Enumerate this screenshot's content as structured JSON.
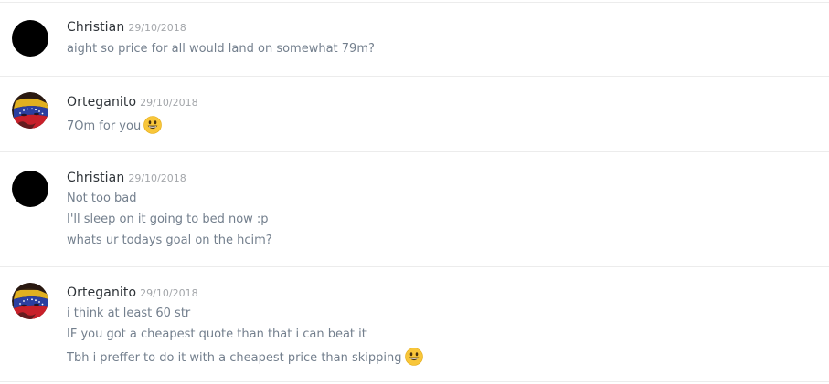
{
  "messages": [
    {
      "author": "Christian",
      "timestamp": "29/10/2018",
      "avatar": "black-circle-avatar",
      "lines": [
        {
          "text": "aight so price for all would land on somewhat 79m?",
          "emoji": null
        }
      ]
    },
    {
      "author": "Orteganito",
      "timestamp": "29/10/2018",
      "avatar": "flag-face-avatar",
      "lines": [
        {
          "text": "7Om for you",
          "emoji": "smiley-emoji"
        }
      ]
    },
    {
      "author": "Christian",
      "timestamp": "29/10/2018",
      "avatar": "black-circle-avatar",
      "lines": [
        {
          "text": "Not too bad",
          "emoji": null
        },
        {
          "text": "I'll sleep on it going to bed now :p",
          "emoji": null
        },
        {
          "text": "whats ur todays goal on the hcim?",
          "emoji": null
        }
      ]
    },
    {
      "author": "Orteganito",
      "timestamp": "29/10/2018",
      "avatar": "flag-face-avatar",
      "lines": [
        {
          "text": "i think at least 60 str",
          "emoji": null
        },
        {
          "text": "IF you got a cheapest quote than that i can beat it",
          "emoji": null
        },
        {
          "text": "Tbh i preffer to do it with a cheapest price than skipping",
          "emoji": "smiley-emoji"
        }
      ]
    }
  ],
  "colors": {
    "username": "#2e3338",
    "timestamp": "#a3a6aa",
    "message_text": "#737f8d",
    "divider": "#ececec"
  }
}
